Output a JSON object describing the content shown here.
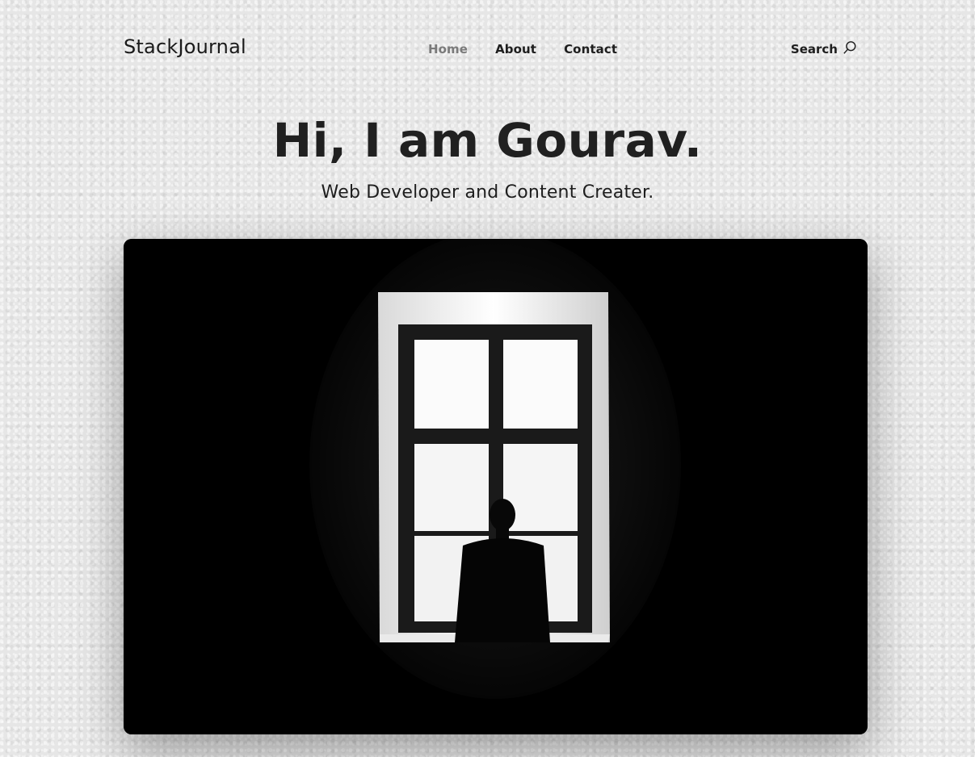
{
  "site": {
    "brand": "StackJournal"
  },
  "nav": {
    "items": [
      {
        "label": "Home",
        "active": true
      },
      {
        "label": "About",
        "active": false
      },
      {
        "label": "Contact",
        "active": false
      }
    ],
    "search_label": "Search",
    "search_icon": "search-icon"
  },
  "hero": {
    "title": "Hi, I am Gourav.",
    "subtitle": "Web Developer and Content Creater.",
    "image_icon": "window-silhouette-photo"
  },
  "colors": {
    "text": "#1c1c1c",
    "nav_active": "#7a7a7a",
    "background": "#e6e6e6",
    "image_bg": "#000000"
  }
}
